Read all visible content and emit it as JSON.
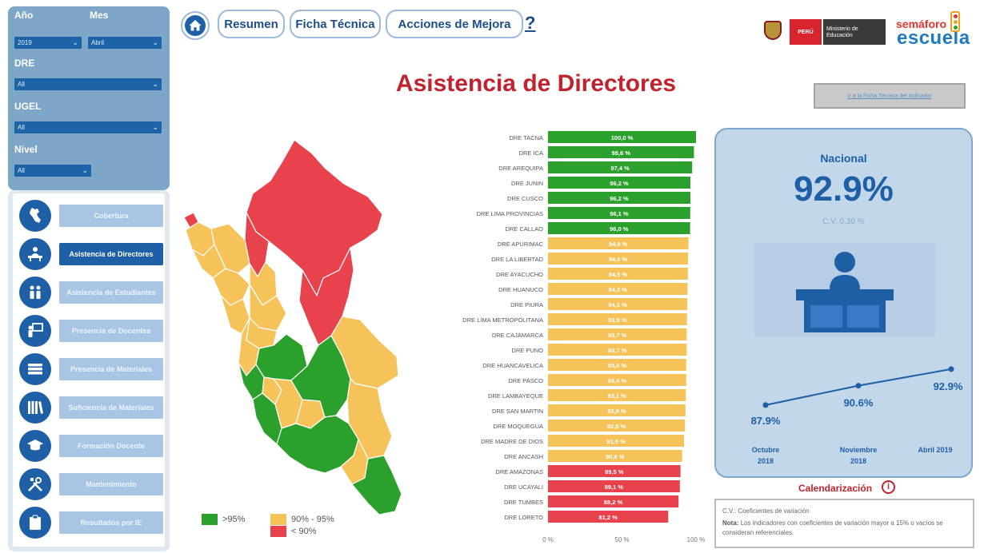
{
  "filters": {
    "anio_label": "Año",
    "anio_value": "2019",
    "mes_label": "Mes",
    "mes_value": "Abril",
    "dre_label": "DRE",
    "dre_value": "All",
    "ugel_label": "UGEL",
    "ugel_value": "All",
    "nivel_label": "Nivel",
    "nivel_value": "All"
  },
  "sidebar": {
    "items": [
      {
        "label": "Cobertura",
        "icon": "peru-map-icon",
        "active": false
      },
      {
        "label": "Asistencia de Directores",
        "icon": "director-desk-icon",
        "active": true
      },
      {
        "label": "Asistencia de Estudiantes",
        "icon": "students-icon",
        "active": false
      },
      {
        "label": "Presencia de Docentes",
        "icon": "teacher-board-icon",
        "active": false
      },
      {
        "label": "Presencia de Materiales",
        "icon": "books-stack-icon",
        "active": false
      },
      {
        "label": "Suficiencia de Materiales",
        "icon": "bookshelf-icon",
        "active": false
      },
      {
        "label": "Formación Docente",
        "icon": "graduation-cap-icon",
        "active": false
      },
      {
        "label": "Mantenimiento",
        "icon": "tools-icon",
        "active": false
      },
      {
        "label": "Resultados por IE",
        "icon": "clipboard-icon",
        "active": false
      }
    ]
  },
  "topnav": {
    "home_icon": "home-icon",
    "tabs": [
      "Resumen",
      "Ficha Técnica",
      "Acciones de Mejora"
    ],
    "help": "?"
  },
  "logos": {
    "peru": "PERÚ",
    "ministerio": "Ministerio de Educación",
    "semaforo": "semáforo",
    "escuela": "escuela"
  },
  "page": {
    "title": "Asistencia de Directores",
    "ficha_link": "Ir a la Ficha Técnica del Indicador"
  },
  "map": {
    "legend": [
      ">95%",
      "90% - 95%",
      "< 90%"
    ],
    "colors": {
      "green": "#2ca02c",
      "yellow": "#f6c35b",
      "red": "#e8424c"
    }
  },
  "chart_data": {
    "type": "bar",
    "orientation": "horizontal",
    "categories": [
      "DRE TACNA",
      "DRE ICA",
      "DRE AREQUIPA",
      "DRE JUNIN",
      "DRE CUSCO",
      "DRE LIMA PROVINCIAS",
      "DRE CALLAO",
      "DRE APURIMAC",
      "DRE LA LIBERTAD",
      "DRE AYACUCHO",
      "DRE HUANUCO",
      "DRE PIURA",
      "DRE LIMA METROPOLITANA",
      "DRE CAJAMARCA",
      "DRE PUNO",
      "DRE HUANCAVELICA",
      "DRE PASCO",
      "DRE LAMBAYEQUE",
      "DRE SAN MARTIN",
      "DRE MOQUEGUA",
      "DRE MADRE DE DIOS",
      "DRE ANCASH",
      "DRE AMAZONAS",
      "DRE UCAYALI",
      "DRE TUMBES",
      "DRE LORETO"
    ],
    "values": [
      100.0,
      98.6,
      97.4,
      96.2,
      96.2,
      96.1,
      96.0,
      94.9,
      94.6,
      94.5,
      94.3,
      94.1,
      93.9,
      93.7,
      93.7,
      93.4,
      93.4,
      93.1,
      92.9,
      92.5,
      91.9,
      90.6,
      89.5,
      89.1,
      88.2,
      81.2
    ],
    "value_labels": [
      "100,0 %",
      "98,6 %",
      "97,4 %",
      "96,2 %",
      "96,2 %",
      "96,1 %",
      "96,0 %",
      "94,9 %",
      "94,6 %",
      "94,5 %",
      "94,3 %",
      "94,1 %",
      "93,9 %",
      "93,7 %",
      "93,7 %",
      "93,4 %",
      "93,4 %",
      "93,1 %",
      "92,9 %",
      "92,5 %",
      "91,9 %",
      "90,6 %",
      "89,5 %",
      "89,1 %",
      "88,2 %",
      "81,2 %"
    ],
    "xlim": [
      0,
      100
    ],
    "xticks": [
      "0 %",
      "50 %",
      "100 %"
    ],
    "thresholds": {
      "green_above": 95,
      "yellow_above": 90
    }
  },
  "kpi": {
    "title": "Nacional",
    "value": "92.9%",
    "cv": "C.V. 0.30 %",
    "illustration_icon": "director-desk-icon",
    "trend": {
      "type": "line",
      "values": [
        87.9,
        90.6,
        92.9
      ],
      "value_labels": [
        "87.9%",
        "90.6%",
        "92.9%"
      ],
      "periods": [
        [
          "Octubre",
          "2018"
        ],
        [
          "Noviembre",
          "2018"
        ],
        [
          "Abril 2019"
        ]
      ]
    }
  },
  "calendarizacion": {
    "label": "Calendarización",
    "icon": "info-icon",
    "icon_glyph": "i"
  },
  "note": {
    "line1": "C.V.: Coeficientes de variación",
    "label": "Nota:",
    "text": "Los indicadores con coeficientes de variación mayor a 15% o vacíos se consideran referenciales."
  }
}
